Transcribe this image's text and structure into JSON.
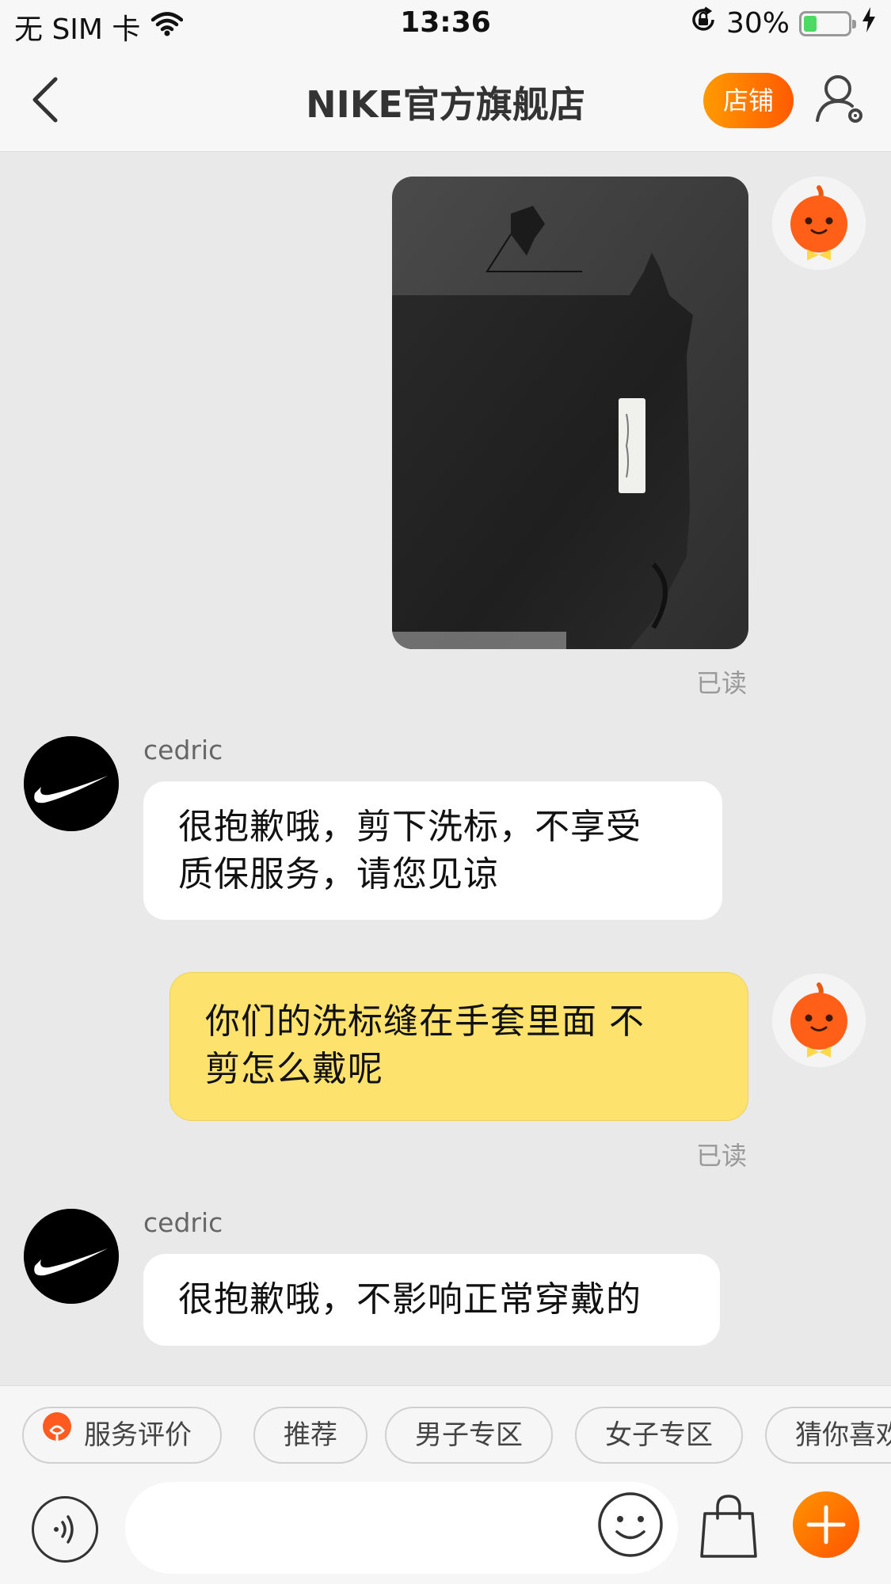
{
  "status_bar": {
    "carrier": "无 SIM 卡",
    "time": "13:36",
    "battery_percent": "30%",
    "battery_level": 0.3
  },
  "nav": {
    "title": "NIKE官方旗舰店",
    "shop_button": "店铺"
  },
  "messages": [
    {
      "type": "image",
      "from": "me",
      "read_status": "已读"
    },
    {
      "type": "text",
      "from": "agent",
      "sender": "cedric",
      "lines": [
        "很抱歉哦，剪下洗标，不享受",
        "质保服务，请您见谅"
      ]
    },
    {
      "type": "text",
      "from": "me",
      "lines": [
        "你们的洗标缝在手套里面 不",
        "剪怎么戴呢"
      ],
      "read_status": "已读"
    },
    {
      "type": "text",
      "from": "agent",
      "sender": "cedric",
      "lines": [
        "很抱歉哦，不影响正常穿戴的"
      ]
    }
  ],
  "quick_replies": [
    "服务评价",
    "推荐",
    "男子专区",
    "女子专区",
    "猜你喜欢"
  ],
  "input": {
    "placeholder": ""
  },
  "colors": {
    "accent_orange": "#ff6a00",
    "my_bubble": "#fde26e",
    "chat_bg": "#e9e9e9",
    "battery_green": "#4cd964"
  }
}
